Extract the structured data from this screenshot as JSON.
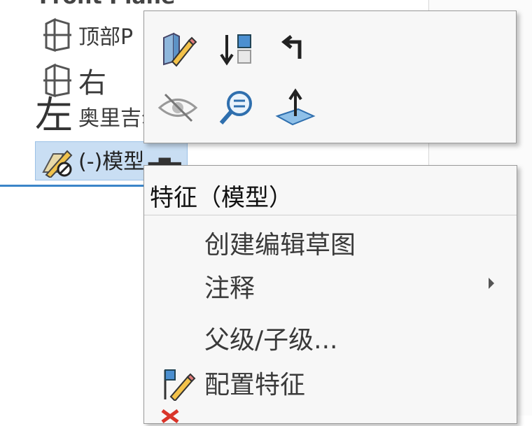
{
  "tree": {
    "top_clipped_label": "Front Plane",
    "items": [
      {
        "label": "顶部P"
      },
      {
        "label": "右"
      },
      {
        "label": "奥里吉尔"
      }
    ],
    "left_overlay": "左",
    "model_label": "(-)模型"
  },
  "context_toolbar": {
    "buttons": [
      {
        "icon": "edit-sketch-icon"
      },
      {
        "icon": "rollback-icon"
      },
      {
        "icon": "parent-icon"
      },
      {
        "icon": "hide-icon"
      },
      {
        "icon": "zoom-to-selection-icon"
      },
      {
        "icon": "normal-to-icon"
      }
    ]
  },
  "context_menu": {
    "header": "特征（模型）",
    "items": [
      {
        "label": "创建编辑草图"
      },
      {
        "label": "注释",
        "has_submenu": true
      },
      {
        "label": "父级/子级..."
      },
      {
        "label": "配置特征",
        "icon": "configure-feature-icon"
      }
    ]
  },
  "colors": {
    "selection": "#c9def3",
    "accent_blue": "#3b85c8",
    "menu_bg": "#f7f7f7"
  }
}
